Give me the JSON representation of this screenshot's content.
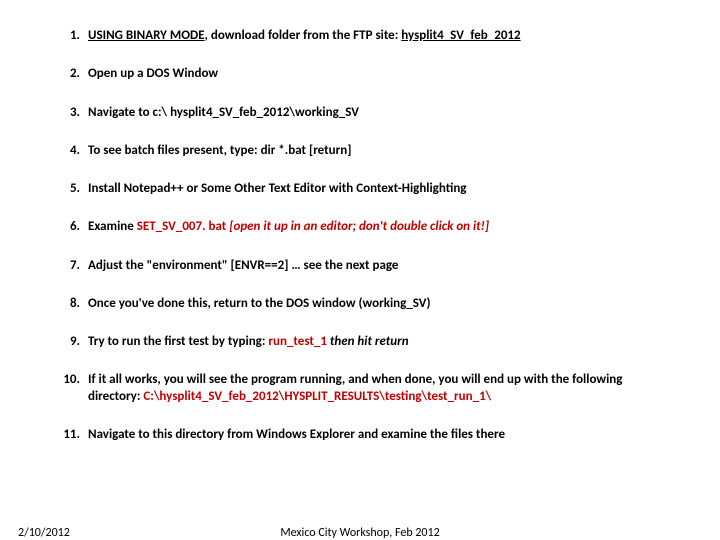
{
  "items": {
    "1": {
      "num": "1.",
      "a": "USING BINARY MODE",
      "b": ", download folder from the FTP site: ",
      "c": "hysplit4_SV_feb_2012"
    },
    "2": {
      "num": "2.",
      "a": "Open up a DOS Window"
    },
    "3": {
      "num": "3.",
      "a": "Navigate to c:\\ hysplit4_SV_feb_2012\\working_SV"
    },
    "4": {
      "num": "4.",
      "a": "To see batch files present, type: dir *.bat [return]"
    },
    "5": {
      "num": "5.",
      "a": "Install Notepad++ or Some Other Text Editor with Context-Highlighting"
    },
    "6": {
      "num": "6.",
      "a": "Examine ",
      "b": "SET_SV_007. bat",
      "c": "  [open it up in an editor; don't double click on it!]"
    },
    "7": {
      "num": "7.",
      "a": "Adjust the \"environment\" [ENVR==2] … see the next page"
    },
    "8": {
      "num": "8.",
      "a": "Once you've done this, return to the DOS window (working_SV)"
    },
    "9": {
      "num": "9.",
      "a": "Try to run the first test by typing: ",
      "b": " run_test_1",
      "c": " then hit return"
    },
    "10": {
      "num": "10.",
      "a": "If it all works, you will see the program running, and when done, you will end up with the following directory: ",
      "b": "C:\\hysplit4_SV_feb_2012\\HYSPLIT_RESULTS\\testing\\test_run_1\\"
    },
    "11": {
      "num": "11.",
      "a": "Navigate to this directory from Windows Explorer and examine the files there"
    }
  },
  "footer": {
    "date": "2/10/2012",
    "center": "Mexico City Workshop, Feb 2012"
  }
}
